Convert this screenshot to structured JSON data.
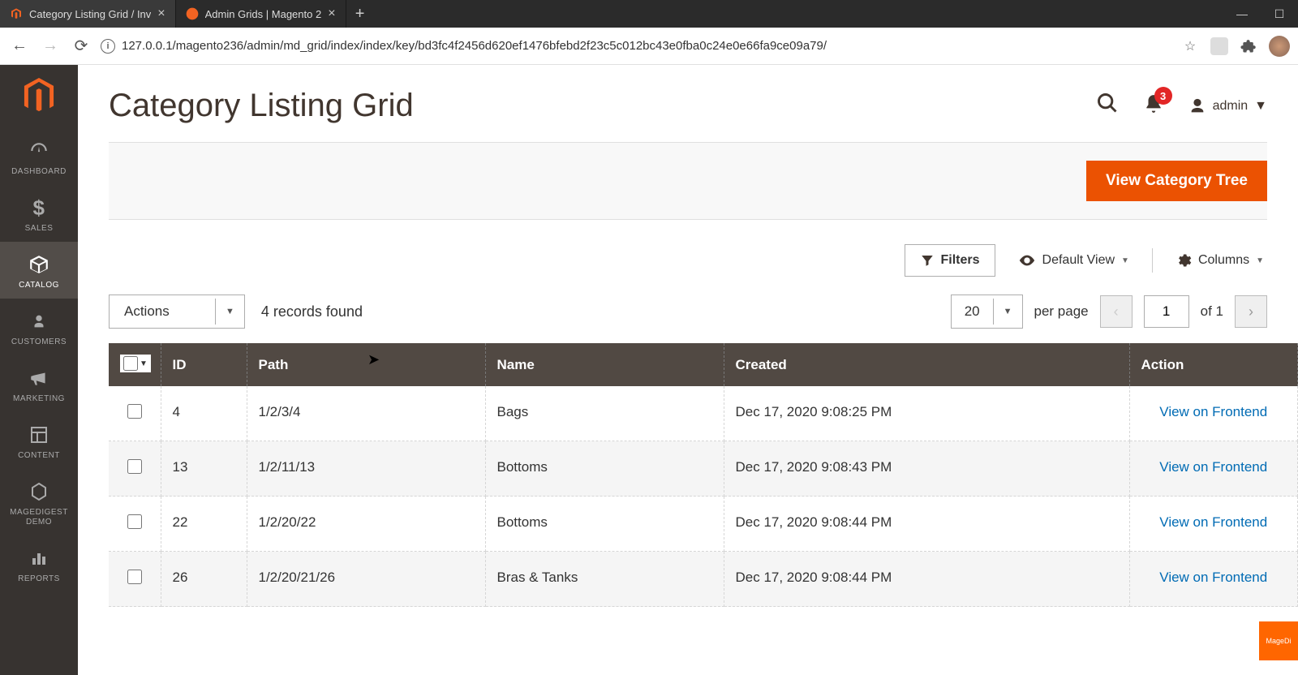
{
  "browser": {
    "tabs": [
      {
        "title": "Category Listing Grid / Inv",
        "active": true
      },
      {
        "title": "Admin Grids | Magento 2",
        "active": false
      }
    ],
    "url": "127.0.0.1/magento236/admin/md_grid/index/index/key/bd3fc4f2456d620ef1476bfebd2f23c5c012bc43e0fba0c24e0e66fa9ce09a79/"
  },
  "sidebar": {
    "items": [
      {
        "label": "DASHBOARD",
        "icon": "gauge-icon"
      },
      {
        "label": "SALES",
        "icon": "dollar-icon"
      },
      {
        "label": "CATALOG",
        "icon": "box-icon",
        "active": true
      },
      {
        "label": "CUSTOMERS",
        "icon": "person-icon"
      },
      {
        "label": "MARKETING",
        "icon": "megaphone-icon"
      },
      {
        "label": "CONTENT",
        "icon": "layout-icon"
      },
      {
        "label": "MAGEDIGEST DEMO",
        "icon": "hex-icon"
      },
      {
        "label": "REPORTS",
        "icon": "barchart-icon"
      }
    ]
  },
  "header": {
    "title": "Category Listing Grid",
    "notifications": "3",
    "user": "admin"
  },
  "actions": {
    "primary": "View Category Tree"
  },
  "toolbar": {
    "filters": "Filters",
    "default_view": "Default View",
    "columns": "Columns",
    "actions_label": "Actions",
    "records_found": "4 records found",
    "per_page_n": "20",
    "per_page_label": "per page",
    "page_current": "1",
    "page_of": "of 1"
  },
  "grid": {
    "columns": [
      "ID",
      "Path",
      "Name",
      "Created",
      "Action"
    ],
    "action_link_label": "View on Frontend",
    "rows": [
      {
        "id": "4",
        "path": "1/2/3/4",
        "name": "Bags",
        "created": "Dec 17, 2020 9:08:25 PM"
      },
      {
        "id": "13",
        "path": "1/2/11/13",
        "name": "Bottoms",
        "created": "Dec 17, 2020 9:08:43 PM"
      },
      {
        "id": "22",
        "path": "1/2/20/22",
        "name": "Bottoms",
        "created": "Dec 17, 2020 9:08:44 PM"
      },
      {
        "id": "26",
        "path": "1/2/20/21/26",
        "name": "Bras & Tanks",
        "created": "Dec 17, 2020 9:08:44 PM"
      }
    ]
  },
  "floater": "MageDi"
}
